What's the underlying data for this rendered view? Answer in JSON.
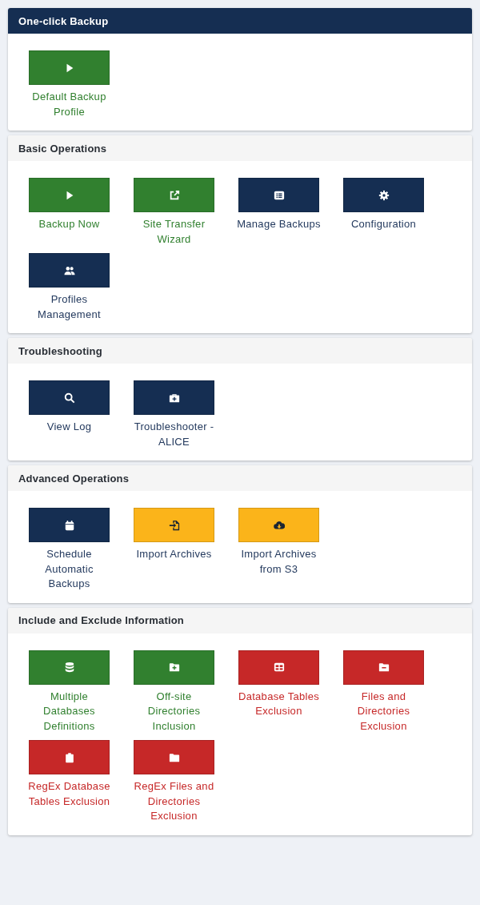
{
  "sections": [
    {
      "title": "One-click Backup",
      "highlighted": true,
      "tiles": [
        {
          "label": "Default Backup Profile",
          "kind": "success"
        }
      ]
    },
    {
      "title": "Basic Operations",
      "highlighted": false,
      "tiles": [
        {
          "label": "Backup Now",
          "kind": "success"
        },
        {
          "label": "Site Transfer Wizard",
          "kind": "success"
        },
        {
          "label": "Manage Backups",
          "kind": "primary"
        },
        {
          "label": "Configuration",
          "kind": "primary"
        },
        {
          "label": "Profiles Management",
          "kind": "primary"
        }
      ]
    },
    {
      "title": "Troubleshooting",
      "highlighted": false,
      "tiles": [
        {
          "label": "View Log",
          "kind": "primary"
        },
        {
          "label": "Troubleshooter - ALICE",
          "kind": "primary"
        }
      ]
    },
    {
      "title": "Advanced Operations",
      "highlighted": false,
      "tiles": [
        {
          "label": "Schedule Automatic Backups",
          "kind": "primary"
        },
        {
          "label": "Import Archives",
          "kind": "warning"
        },
        {
          "label": "Import Archives from S3",
          "kind": "warning"
        }
      ]
    },
    {
      "title": "Include and Exclude Information",
      "highlighted": false,
      "tiles": [
        {
          "label": "Multiple Databases Definitions",
          "kind": "success"
        },
        {
          "label": "Off-site Directories Inclusion",
          "kind": "success"
        },
        {
          "label": "Database Tables Exclusion",
          "kind": "danger"
        },
        {
          "label": "Files and Directories Exclusion",
          "kind": "danger"
        },
        {
          "label": "RegEx Database Tables Exclusion",
          "kind": "danger"
        },
        {
          "label": "RegEx Files and Directories Exclusion",
          "kind": "danger"
        }
      ]
    }
  ]
}
